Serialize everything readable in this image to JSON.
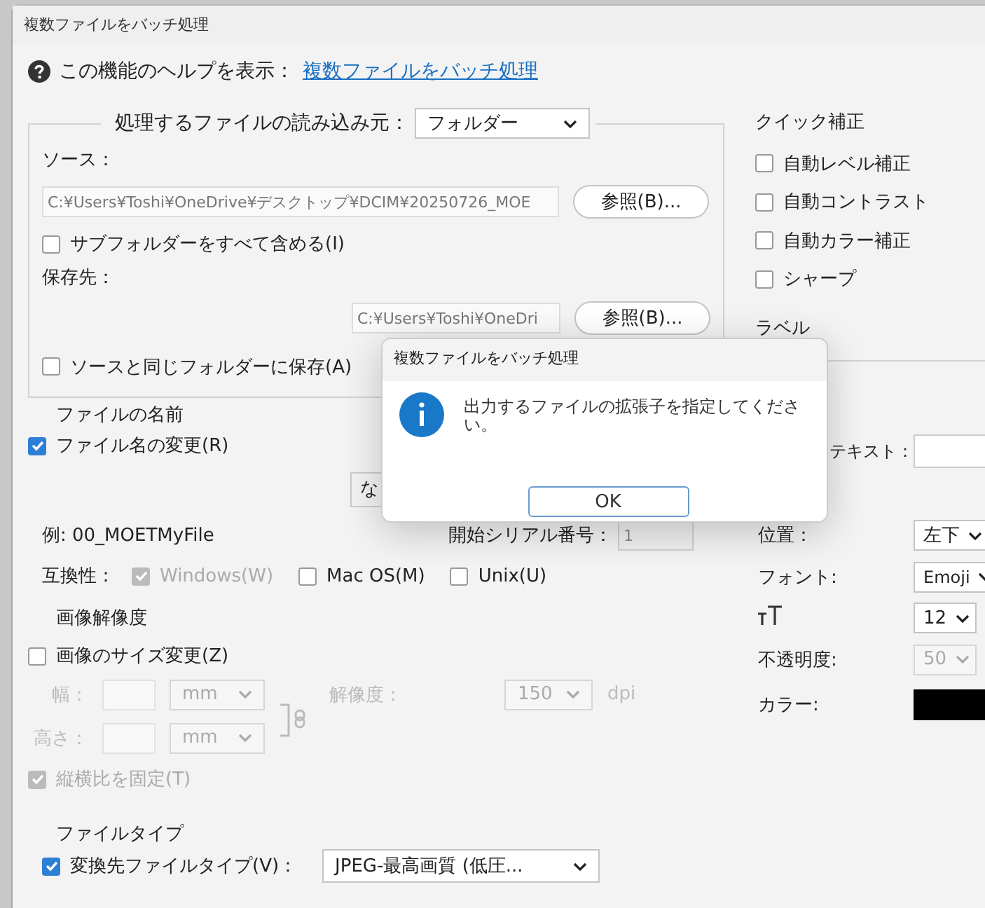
{
  "window": {
    "title": "複数ファイルをバッチ処理"
  },
  "help": {
    "label": "この機能のヘルプを表示：",
    "link": "複数ファイルをバッチ処理"
  },
  "input_group": {
    "label": "処理するファイルの読み込み元：",
    "source_kind": "フォルダー",
    "source_label": "ソース：",
    "source_path": "C:¥Users¥Toshi¥OneDrive¥デスクトップ¥DCIM¥20250726_MOE",
    "source_browse": "参照(B)...",
    "include_subfolders": {
      "label": "サブフォルダーをすべて含める(I)",
      "checked": false
    },
    "dest_label": "保存先：",
    "dest_path": "C:¥Users¥Toshi¥OneDri",
    "dest_browse": "参照(B)...",
    "same_folder": {
      "label": "ソースと同じフォルダーに保存(A)",
      "checked": false
    }
  },
  "file_name": {
    "heading": "ファイルの名前",
    "rename": {
      "label": "ファイル名の変更(R)",
      "checked": true
    },
    "name_part": "な",
    "example": "例: 00_MOETMyFile",
    "serial_label": "開始シリアル番号：",
    "serial_value": "1",
    "serial_disabled": true,
    "compat_label": "互換性：",
    "compat": [
      {
        "label": "Windows(W)",
        "checked": true,
        "disabled": true
      },
      {
        "label": "Mac OS(M)",
        "checked": false,
        "disabled": false
      },
      {
        "label": "Unix(U)",
        "checked": false,
        "disabled": false
      }
    ]
  },
  "resolution": {
    "heading": "画像解像度",
    "resize": {
      "label": "画像のサイズ変更(Z)",
      "checked": false
    },
    "disabled": true,
    "width_label": "幅：",
    "height_label": "高さ：",
    "width_unit": "mm",
    "height_unit": "mm",
    "res_label": "解像度：",
    "res_value": "150",
    "res_unit": "dpi",
    "keep_ratio": {
      "label": "縦横比を固定(T)",
      "checked": true
    }
  },
  "file_type": {
    "heading": "ファイルタイプ",
    "convert": {
      "label": "変換先ファイルタイプ(V)：",
      "checked": true
    },
    "type": "JPEG-最高画質 (低圧..."
  },
  "quick_fix": {
    "heading": "クイック補正",
    "options": [
      {
        "label": "自動レベル補正",
        "checked": false
      },
      {
        "label": "自動コントラスト",
        "checked": false
      },
      {
        "label": "自動カラー補正",
        "checked": false
      },
      {
        "label": "シャープ",
        "checked": false
      }
    ]
  },
  "label": {
    "heading": "ラベル",
    "text_label": "テキスト：",
    "position_label": "位置：",
    "position": "左下",
    "font_label": "フォント:",
    "font": "Emoji",
    "size": "12",
    "opacity_label": "不透明度:",
    "opacity": "50",
    "opacity_disabled": true,
    "color_label": "カラー:",
    "color": "#000000"
  },
  "dialog": {
    "title": "複数ファイルをバッチ処理",
    "message": "出力するファイルの拡張子を指定してください。",
    "ok": "OK"
  }
}
